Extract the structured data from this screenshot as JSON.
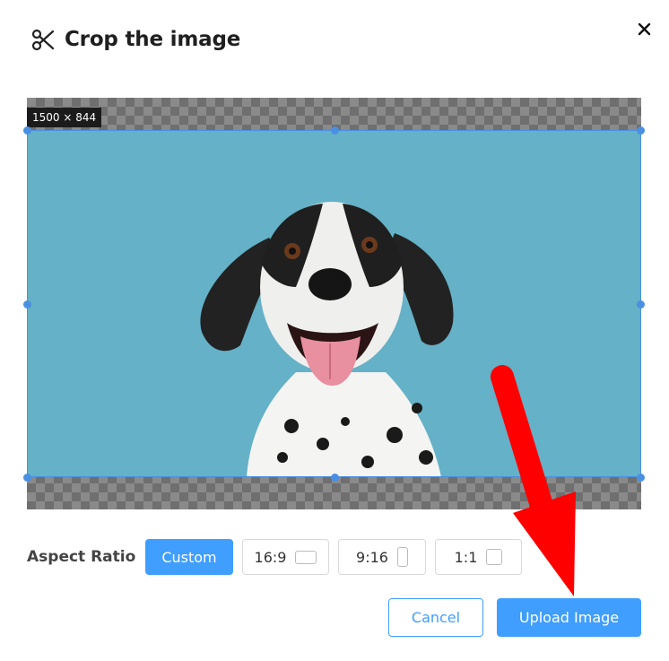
{
  "dialog": {
    "title": "Crop the image",
    "title_icon": "scissors-icon",
    "close_icon": "close-icon"
  },
  "crop": {
    "size_label": "1500 × 844",
    "image_description_icon": "dog-photo"
  },
  "aspect_ratio": {
    "label": "Aspect Ratio",
    "options": [
      {
        "label": "Custom",
        "active": true
      },
      {
        "label": "16:9",
        "icon": "landscape-rect-icon"
      },
      {
        "label": "9:16",
        "icon": "portrait-rect-icon"
      },
      {
        "label": "1:1",
        "icon": "square-icon"
      }
    ]
  },
  "actions": {
    "cancel_label": "Cancel",
    "upload_label": "Upload Image"
  },
  "colors": {
    "accent": "#409eff",
    "annotation_arrow": "#ff0000"
  }
}
